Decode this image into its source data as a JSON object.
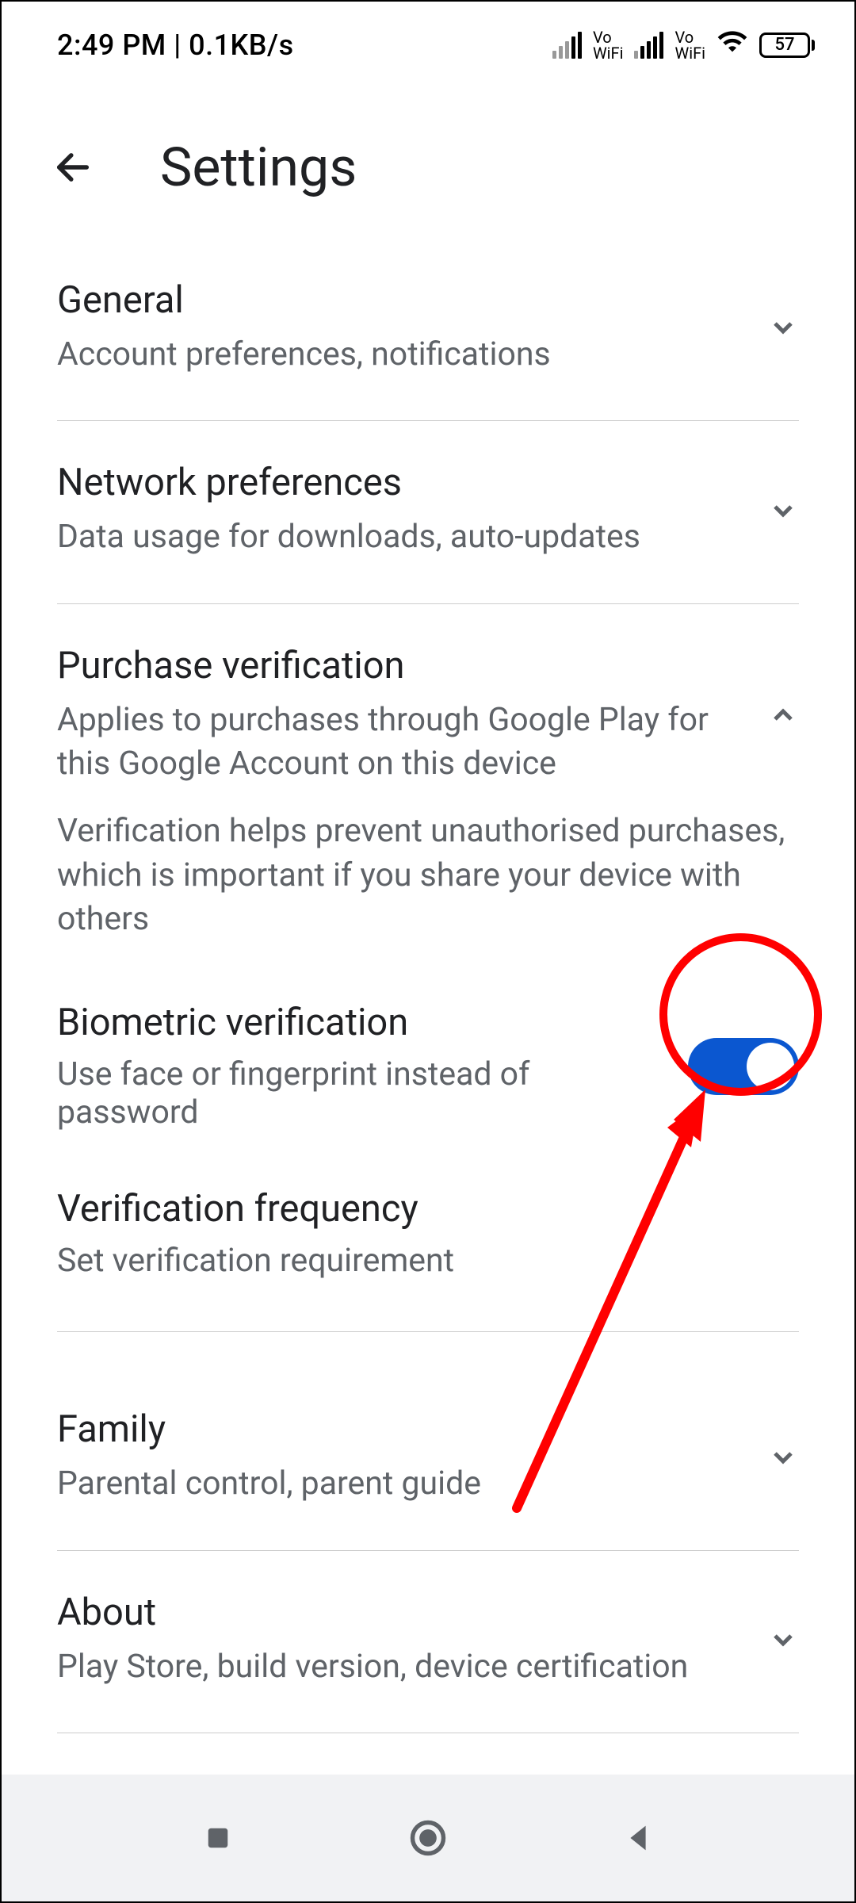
{
  "status": {
    "time": "2:49 PM",
    "network_speed": "0.1KB/s",
    "vowifi1": "Vo\nWiFi",
    "vowifi2": "Vo\nWiFi",
    "battery": "57"
  },
  "header": {
    "title": "Settings"
  },
  "sections": {
    "general": {
      "title": "General",
      "subtitle": "Account preferences, notifications"
    },
    "network": {
      "title": "Network preferences",
      "subtitle": "Data usage for downloads, auto-updates"
    },
    "purchase": {
      "title": "Purchase verification",
      "subtitle": "Applies to purchases through Google Play for this Google Account on this device",
      "info": "Verification helps prevent unauthorised purchases, which is important if you share your device with others",
      "biometric": {
        "title": "Biometric verification",
        "subtitle": "Use face or fingerprint instead of password",
        "enabled": true
      },
      "frequency": {
        "title": "Verification frequency",
        "subtitle": "Set verification requirement"
      }
    },
    "family": {
      "title": "Family",
      "subtitle": "Parental control, parent guide"
    },
    "about": {
      "title": "About",
      "subtitle": "Play Store, build version, device certification"
    }
  }
}
